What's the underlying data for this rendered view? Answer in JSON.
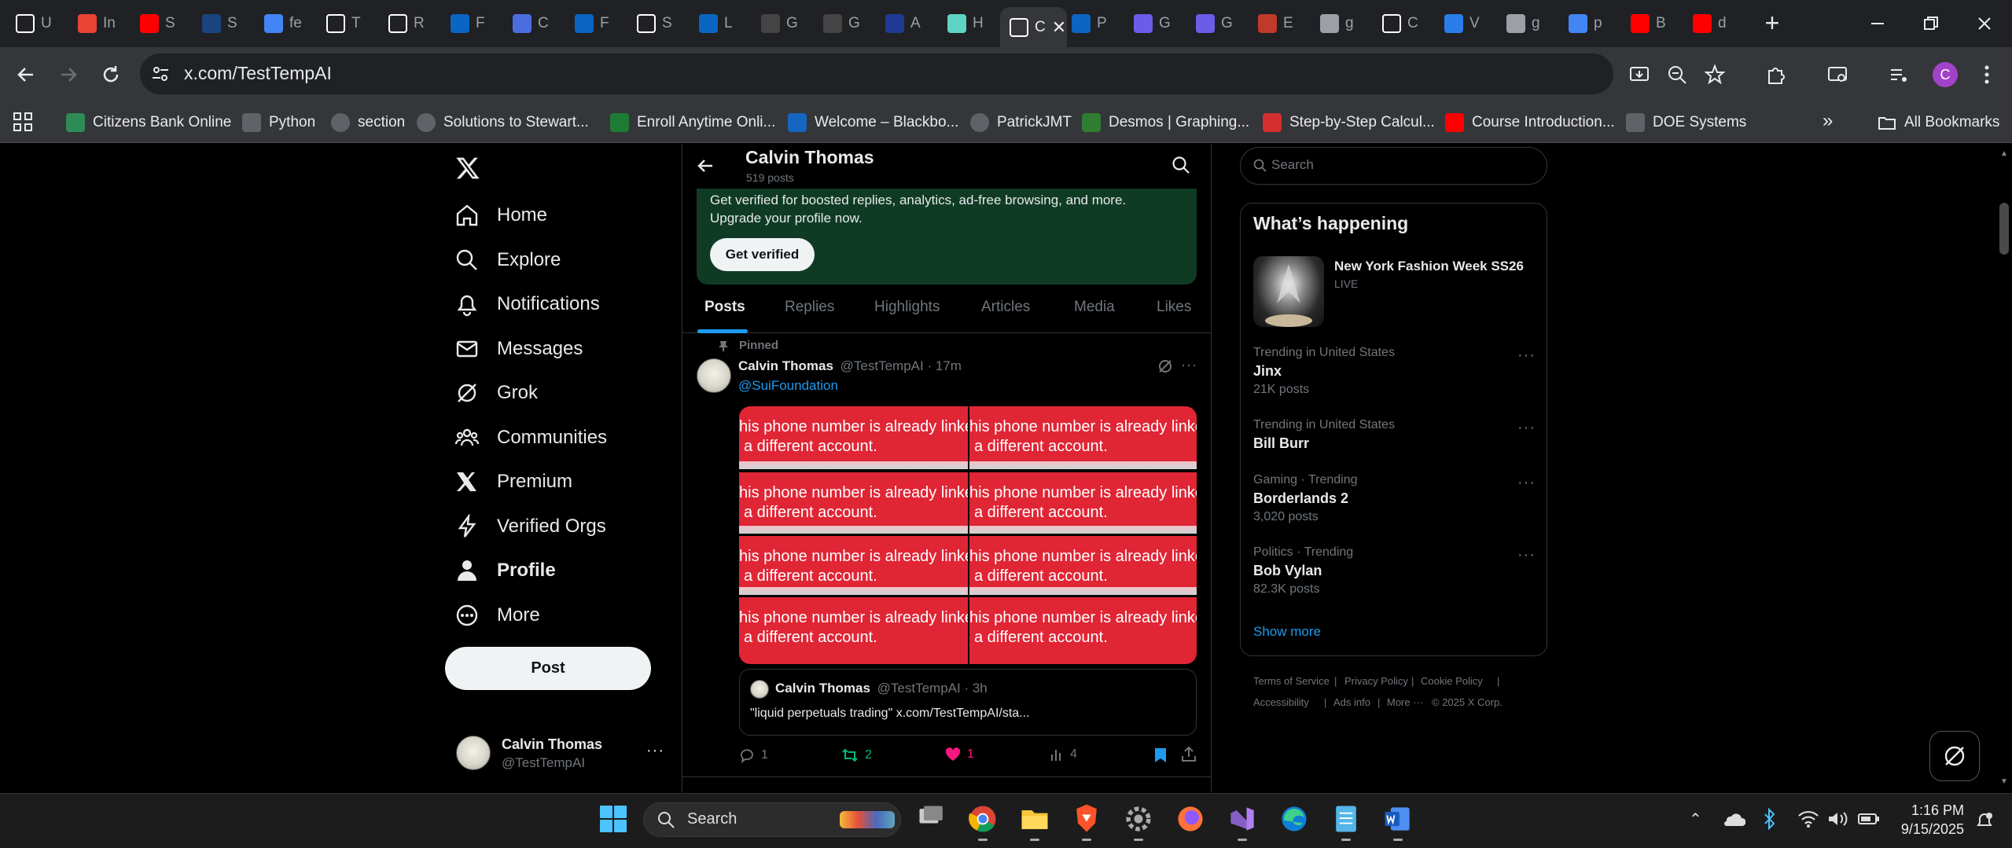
{
  "browser": {
    "tabs": [
      {
        "label": "U",
        "icon": "github-icon",
        "color": "#ffffff"
      },
      {
        "label": "In",
        "icon": "gmail-icon",
        "color": "#ea4335"
      },
      {
        "label": "S",
        "icon": "youtube-icon",
        "color": "#ff0000"
      },
      {
        "label": "S",
        "icon": "ssn-icon",
        "color": "#1a4480"
      },
      {
        "label": "fe",
        "icon": "google-icon",
        "color": "#4285f4"
      },
      {
        "label": "T",
        "icon": "rc-icon",
        "color": "#ffffff"
      },
      {
        "label": "R",
        "icon": "rc-icon",
        "color": "#ffffff"
      },
      {
        "label": "F",
        "icon": "linkedin-icon",
        "color": "#0a66c2"
      },
      {
        "label": "C",
        "icon": "m-icon",
        "color": "#4a6ee0"
      },
      {
        "label": "F",
        "icon": "linkedin-icon",
        "color": "#0a66c2"
      },
      {
        "label": "S",
        "icon": "sparkle-icon",
        "color": "#ffffff"
      },
      {
        "label": "L",
        "icon": "linkedin-icon",
        "color": "#0a66c2"
      },
      {
        "label": "G",
        "icon": "github-dark-icon",
        "color": "#444444"
      },
      {
        "label": "G",
        "icon": "github-dark-icon",
        "color": "#444444"
      },
      {
        "label": "A",
        "icon": "a-icon",
        "color": "#1f3a93"
      },
      {
        "label": "H",
        "icon": "hugging-icon",
        "color": "#5fd3c4"
      },
      {
        "label": "C",
        "icon": "x-icon",
        "color": "#ffffff",
        "active": true
      },
      {
        "label": "P",
        "icon": "linkedin-icon",
        "color": "#0a66c2"
      },
      {
        "label": "G",
        "icon": "arrow-icon",
        "color": "#6c5ce7"
      },
      {
        "label": "G",
        "icon": "arrow-icon",
        "color": "#6c5ce7"
      },
      {
        "label": "E",
        "icon": "e-icon",
        "color": "#c0392b"
      },
      {
        "label": "g",
        "icon": "globe-icon",
        "color": "#9aa0a6"
      },
      {
        "label": "C",
        "icon": "x-icon",
        "color": "#ffffff"
      },
      {
        "label": "V",
        "icon": "v-icon",
        "color": "#2b7de9"
      },
      {
        "label": "g",
        "icon": "globe-icon",
        "color": "#9aa0a6"
      },
      {
        "label": "p",
        "icon": "google-icon",
        "color": "#4285f4"
      },
      {
        "label": "B",
        "icon": "youtube-icon",
        "color": "#ff0000"
      },
      {
        "label": "d",
        "icon": "youtube-icon",
        "color": "#ff0000"
      }
    ],
    "url": "x.com/TestTempAI",
    "bookmarks": [
      {
        "label": "Citizens Bank Online",
        "icon": "citizens-icon",
        "color": "#2e8b57"
      },
      {
        "label": "Python",
        "icon": "folder-icon",
        "color": "#5f6368"
      },
      {
        "label": "section",
        "icon": "globe-icon",
        "color": "#5f6368"
      },
      {
        "label": "Solutions to Stewart...",
        "icon": "globe-icon",
        "color": "#5f6368"
      },
      {
        "label": "Enroll Anytime Onli...",
        "icon": "uni-icon",
        "color": "#1e7b34"
      },
      {
        "label": "Welcome – Blackbo...",
        "icon": "blackboard-icon",
        "color": "#1565c0"
      },
      {
        "label": "PatrickJMT",
        "icon": "globe-icon",
        "color": "#5f6368"
      },
      {
        "label": "Desmos | Graphing...",
        "icon": "desmos-icon",
        "color": "#2e7d32"
      },
      {
        "label": "Step-by-Step Calcul...",
        "icon": "symbolab-icon",
        "color": "#d32f2f"
      },
      {
        "label": "Course Introduction...",
        "icon": "youtube-icon",
        "color": "#ff0000"
      },
      {
        "label": "DOE Systems",
        "icon": "shield-icon",
        "color": "#5f6368"
      }
    ],
    "all_bookmarks": "All Bookmarks",
    "avatar_letter": "C"
  },
  "nav": {
    "items": [
      {
        "label": "Home",
        "icon": "home-icon"
      },
      {
        "label": "Explore",
        "icon": "search-icon"
      },
      {
        "label": "Notifications",
        "icon": "bell-icon"
      },
      {
        "label": "Messages",
        "icon": "mail-icon"
      },
      {
        "label": "Grok",
        "icon": "grok-icon"
      },
      {
        "label": "Communities",
        "icon": "communities-icon"
      },
      {
        "label": "Premium",
        "icon": "x-icon"
      },
      {
        "label": "Verified Orgs",
        "icon": "bolt-icon"
      },
      {
        "label": "Profile",
        "icon": "person-icon"
      },
      {
        "label": "More",
        "icon": "more-circle-icon"
      }
    ],
    "post_label": "Post",
    "account": {
      "name": "Calvin Thomas",
      "handle": "@TestTempAI"
    }
  },
  "profile": {
    "name": "Calvin Thomas",
    "posts_count": "519 posts",
    "verify_line1": "Get verified for boosted replies, analytics, ad-free browsing, and more.",
    "verify_line2": "Upgrade your profile now.",
    "verify_button": "Get verified",
    "tabs": [
      "Posts",
      "Replies",
      "Highlights",
      "Articles",
      "Media",
      "Likes"
    ]
  },
  "tweet": {
    "pinned_label": "Pinned",
    "name": "Calvin Thomas",
    "meta": "@TestTempAI · 17m",
    "mention": "@SuiFoundation",
    "image_line1": "his phone number is already linke",
    "image_line2": "a different account.",
    "quote": {
      "name": "Calvin Thomas",
      "meta": "@TestTempAI · 3h",
      "text": "\"liquid perpetuals trading\" x.com/TestTempAI/sta..."
    },
    "replies": "1",
    "reposts": "2",
    "likes": "1",
    "views": "4"
  },
  "sidebar": {
    "search_placeholder": "Search",
    "whats_happening": "What’s happening",
    "featured": {
      "title": "New York Fashion Week SS26",
      "status": "LIVE"
    },
    "trends": [
      {
        "meta": "Trending in United States",
        "title": "Jinx",
        "count": "21K posts"
      },
      {
        "meta": "Trending in United States",
        "title": "Bill Burr",
        "count": ""
      },
      {
        "meta": "Gaming · Trending",
        "title": "Borderlands 2",
        "count": "3,020 posts"
      },
      {
        "meta": "Politics · Trending",
        "title": "Bob Vylan",
        "count": "82.3K posts"
      }
    ],
    "show_more": "Show more",
    "footer": [
      "Terms of Service",
      "|",
      "Privacy Policy",
      "|",
      "Cookie Policy",
      "|",
      "Accessibility",
      "|",
      "Ads info",
      "|",
      "More ···",
      "© 2025 X Corp."
    ]
  },
  "taskbar": {
    "search_label": "Search",
    "time": "1:16 PM",
    "date": "9/15/2025"
  },
  "colors": {
    "accent": "#1d9bf0",
    "repost_green": "#00ba7c",
    "like_pink": "#f91880",
    "verify_bg": "#0f3b25",
    "image_red": "#e02535"
  }
}
